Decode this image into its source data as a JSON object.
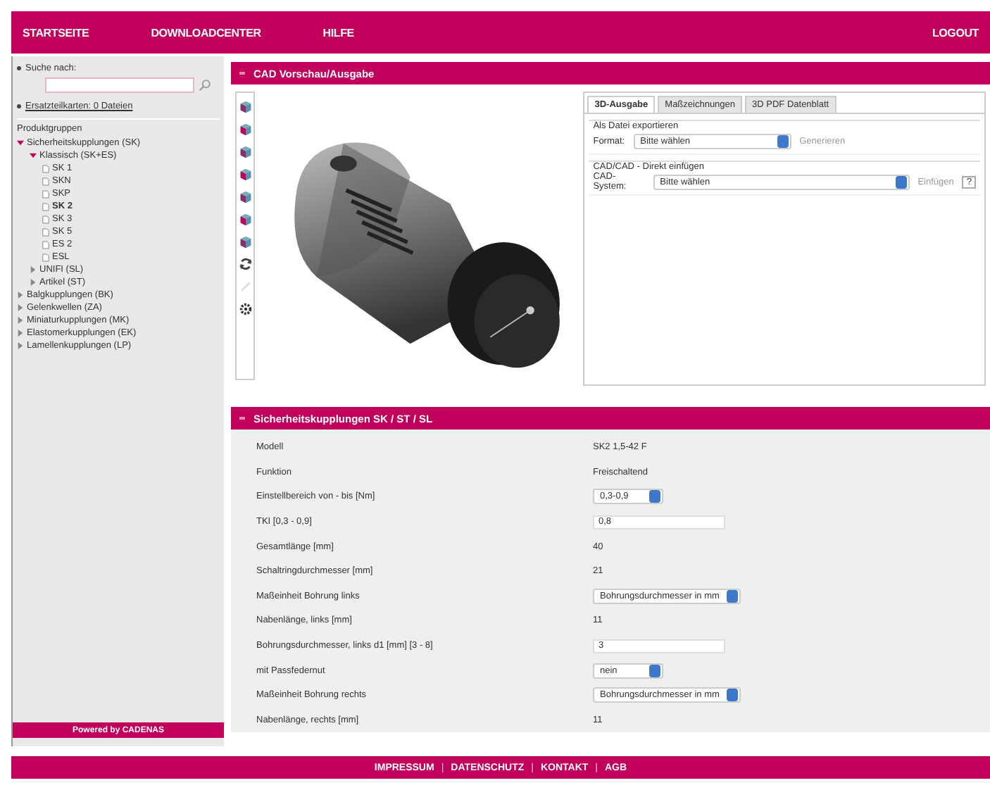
{
  "nav": {
    "items": [
      {
        "label": "STARTSEITE"
      },
      {
        "label": "DOWNLOADCENTER"
      },
      {
        "label": "HILFE"
      }
    ],
    "logout": "LOGOUT"
  },
  "sidebar": {
    "search_label": "Suche nach:",
    "spare_parts_link": "Ersatzteilkarten: 0 Dateien",
    "tree_title": "Produktgruppen",
    "tree": [
      {
        "label": "Sicherheitskupplungen (SK)",
        "expanded": true,
        "children": [
          {
            "label": "Klassisch (SK+ES)",
            "expanded": true,
            "children": [
              {
                "label": "SK 1",
                "selected": false
              },
              {
                "label": "SKN",
                "selected": false
              },
              {
                "label": "SKP",
                "selected": false
              },
              {
                "label": "SK 2",
                "selected": true
              },
              {
                "label": "SK 3",
                "selected": false
              },
              {
                "label": "SK 5",
                "selected": false
              },
              {
                "label": "ES 2",
                "selected": false
              },
              {
                "label": "ESL",
                "selected": false
              }
            ]
          },
          {
            "label": "UNIFI (SL)",
            "expanded": false
          },
          {
            "label": "Artikel (ST)",
            "expanded": false
          }
        ]
      },
      {
        "label": "Balgkupplungen (BK)",
        "expanded": false
      },
      {
        "label": "Gelenkwellen (ZA)",
        "expanded": false
      },
      {
        "label": "Miniaturkupplungen (MK)",
        "expanded": false
      },
      {
        "label": "Elastomerkupplungen (EK)",
        "expanded": false
      },
      {
        "label": "Lamellenkupplungen (LP)",
        "expanded": false
      }
    ],
    "powered_by": "Powered by CADENAS"
  },
  "cad": {
    "title": "CAD Vorschau/Ausgabe",
    "tools": [
      {
        "kind": "cube"
      },
      {
        "kind": "cube"
      },
      {
        "kind": "cube"
      },
      {
        "kind": "cube"
      },
      {
        "kind": "cube"
      },
      {
        "kind": "cube"
      },
      {
        "kind": "cube"
      },
      {
        "kind": "rotate"
      },
      {
        "kind": "pen",
        "disabled": true
      },
      {
        "kind": "gear"
      }
    ],
    "tabs": [
      {
        "label": "3D-Ausgabe",
        "selected": true
      },
      {
        "label": "Maßzeichnungen",
        "selected": false
      },
      {
        "label": "3D PDF Datenblatt",
        "selected": false
      }
    ],
    "export": {
      "legend": "Als Datei exportieren",
      "label": "Format:",
      "value": "Bitte wählen",
      "button": "Generieren"
    },
    "insert": {
      "legend": "CAD/CAD - Direkt einfügen",
      "label": "CAD-System:",
      "value": "Bitte wählen",
      "button": "Einfügen",
      "help": "?"
    }
  },
  "details": {
    "title": "Sicherheitskupplungen SK / ST / SL",
    "rows": [
      {
        "label": "Modell",
        "kind": "text",
        "value": "SK2 1,5-42 F"
      },
      {
        "label": "Funktion",
        "kind": "text",
        "value": "Freischaltend"
      },
      {
        "label": "Einstellbereich von - bis [Nm]",
        "kind": "select",
        "value": "0,3-0,9"
      },
      {
        "label": "TKI [0,3 - 0,9]",
        "kind": "input",
        "value": "0,8"
      },
      {
        "label": "Gesamtlänge [mm]",
        "kind": "text",
        "value": "40"
      },
      {
        "label": "Schaltringdurchmesser [mm]",
        "kind": "text",
        "value": "21"
      },
      {
        "label": "Maßeinheit Bohrung links",
        "kind": "select",
        "value": "Bohrungsdurchmesser in mm"
      },
      {
        "label": "Nabenlänge, links [mm]",
        "kind": "text",
        "value": "11"
      },
      {
        "label": "Bohrungsdurchmesser, links d1 [mm] [3 - 8]",
        "kind": "input",
        "value": "3"
      },
      {
        "label": "mit Passfedernut",
        "kind": "select",
        "value": "nein"
      },
      {
        "label": "Maßeinheit Bohrung rechts",
        "kind": "select",
        "value": "Bohrungsdurchmesser in mm"
      },
      {
        "label": "Nabenlänge, rechts [mm]",
        "kind": "text",
        "value": "11"
      }
    ]
  },
  "footer": [
    {
      "kind": "link",
      "label": "IMPRESSUM"
    },
    {
      "kind": "sep",
      "label": "|"
    },
    {
      "kind": "link",
      "label": "DATENSCHUTZ"
    },
    {
      "kind": "sep",
      "label": "|"
    },
    {
      "kind": "link",
      "label": "KONTAKT"
    },
    {
      "kind": "sep",
      "label": "|"
    },
    {
      "kind": "link",
      "label": "AGB"
    }
  ]
}
